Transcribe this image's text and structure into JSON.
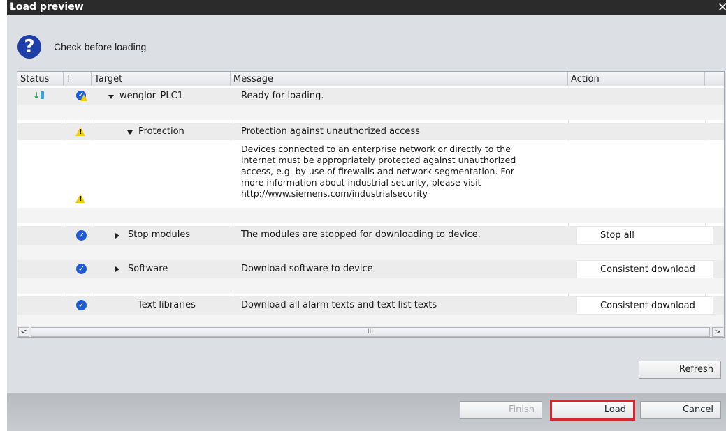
{
  "dialog": {
    "title": "Load preview",
    "header_text": "Check before loading"
  },
  "table": {
    "columns": [
      "Status",
      "!",
      "Target",
      "Message",
      "Action"
    ],
    "rows": [
      {
        "target": "wenglor_PLC1",
        "message": "Ready for loading.",
        "action": "",
        "status_icon": "download-icon",
        "flag_icon": "ok-warning-icon",
        "expander": "expanded"
      },
      {
        "target": "Protection",
        "message": "Protection against unauthorized access",
        "action": "",
        "flag_icon": "warning-icon",
        "expander": "expanded"
      },
      {
        "target": "",
        "message": [
          "Devices connected to an enterprise network or directly to the",
          "internet must be appropriately protected against unauthorized",
          "access, e.g. by use of firewalls and network segmentation. For",
          "more information about industrial security, please visit",
          "http://www.siemens.com/industrialsecurity"
        ],
        "action": "",
        "flag_icon": "warning-icon"
      },
      {
        "target": "Stop modules",
        "message": "The modules are stopped for downloading to device.",
        "action": "Stop all",
        "flag_icon": "ok-icon",
        "expander": "collapsed"
      },
      {
        "target": "Software",
        "message": "Download software to device",
        "action": "Consistent download",
        "flag_icon": "ok-icon",
        "expander": "collapsed"
      },
      {
        "target": "Text libraries",
        "message": "Download all alarm texts and text list texts",
        "action": "Consistent download",
        "flag_icon": "ok-icon"
      }
    ]
  },
  "scrollbar": {
    "left": "<",
    "right": ">",
    "thumb": "III"
  },
  "buttons": {
    "refresh": "Refresh",
    "finish": "Finish",
    "load": "Load",
    "cancel": "Cancel"
  },
  "colors": {
    "highlight": "#d9252b",
    "titlebar": "#2b2b2b",
    "ok_blue": "#1d5bd8",
    "warning_yellow": "#f1cf10"
  }
}
